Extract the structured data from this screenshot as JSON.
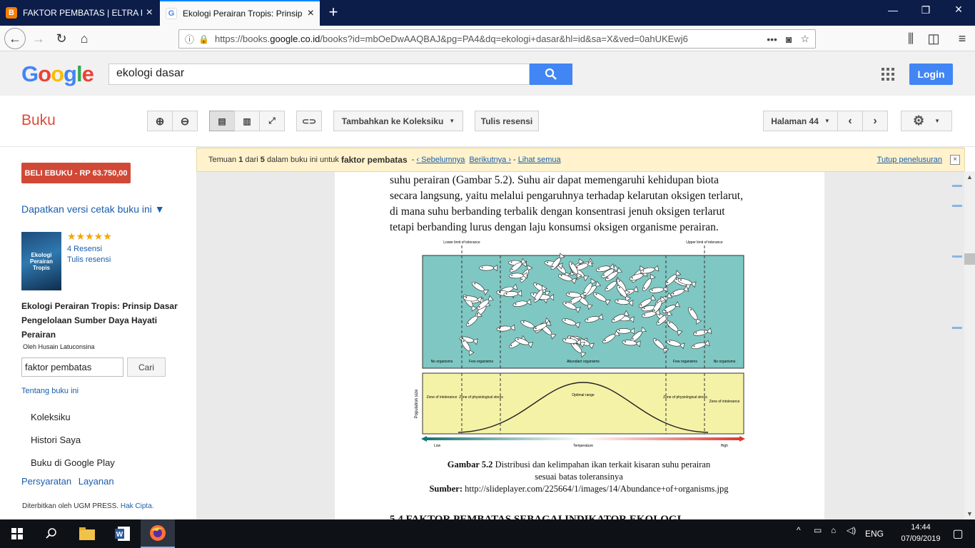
{
  "browser": {
    "tabs": [
      {
        "title": "FAKTOR PEMBATAS | ELTRA BIO",
        "favicon": "blogger-icon"
      },
      {
        "title": "Ekologi Perairan Tropis: Prinsip",
        "favicon": "google-icon"
      }
    ],
    "url_prefix": "https://books.",
    "url_domain": "google.co.id",
    "url_rest": "/books?id=mbOeDwAAQBAJ&pg=PA4&dq=ekologi+dasar&hl=id&sa=X&ved=0ahUKEwj6",
    "url_more": "•••"
  },
  "google": {
    "logo": "Google",
    "search_value": "ekologi dasar",
    "login_label": "Login"
  },
  "toolbar": {
    "section_title": "Buku",
    "add_collection_label": "Tambahkan ke Koleksiku",
    "write_review_label": "Tulis resensi",
    "page_label": "Halaman 44"
  },
  "sidebar": {
    "buy_label": "BELI EBUKU - RP 63.750,00",
    "print_version_label": "Dapatkan versi cetak buku ini ▼",
    "cover_text": "Ekologi Perairan Tropis",
    "rating_stars": "★★★★★",
    "reviews_label": "4 Resensi",
    "write_review_label": "Tulis resensi",
    "book_title": "Ekologi Perairan Tropis: Prinsip Dasar Pengelolaan Sumber Daya Hayati Perairan",
    "author": "Oleh Husain Latuconsina",
    "search_value": "faktor pembatas",
    "search_button": "Cari",
    "about_label": "Tentang buku ini",
    "menu": [
      "Koleksiku",
      "Histori Saya",
      "Buku di Google Play"
    ],
    "terms_label": "Persyaratan",
    "services_label": "Layanan",
    "publisher_text": "Diterbitkan oleh UGM PRESS.",
    "copyright_label": "Hak Cipta."
  },
  "notice": {
    "prefix": "Temuan",
    "current": "1",
    "middle": "dari",
    "total": "5",
    "suffix": "dalam buku ini untuk",
    "term": "faktor pembatas",
    "prev": "‹ Sebelumnya",
    "next": "Berikutnya ›",
    "see_all": "Lihat semua",
    "close": "Tutup penelusuran"
  },
  "page": {
    "lines": [
      "suhu perairan (Gambar 5.2). Suhu air dapat memengaruhi kehidupan biota",
      "secara langsung, yaitu melalui pengaruhnya terhadap kelarutan oksigen terlarut,",
      "di mana suhu berbanding terbalik dengan konsentrasi jenuh oksigen terlarut",
      "tetapi berbanding lurus dengan laju konsumsi oksigen organisme perairan."
    ],
    "figure": {
      "lower_limit": "Lower limit of tolerance",
      "upper_limit": "Upper limit of tolerance",
      "zones_top": [
        "No organisms",
        "Few organisms",
        "Abundant organisms",
        "Few organisms",
        "No organisms"
      ],
      "zones_bottom": [
        "Zone of intolerance",
        "Zone of physiological stress",
        "Optimal range",
        "Zone of physiological stress",
        "Zone of intolerance"
      ],
      "y_axis": "Population size",
      "x_low": "Low",
      "x_mid": "Temperature",
      "x_high": "High"
    },
    "caption_label": "Gambar 5.2",
    "caption_line1": "Distribusi dan kelimpahan ikan terkait kisaran suhu perairan",
    "caption_line2": "sesuai batas toleransinya",
    "source_label": "Sumber:",
    "source_url": "http://slideplayer.com/225664/1/images/14/Abundance+of+organisms.jpg",
    "next_heading": "5.4   FAKTOR PEMBATAS SEBAGAI INDIKATOR EKOLOGI"
  },
  "taskbar": {
    "lang": "ENG",
    "time": "14:44",
    "date": "07/09/2019"
  },
  "colors": {
    "google_blue": "#4285f4",
    "buku_red": "#dd4b39",
    "buy_red": "#d14836",
    "notice_bg": "#fff2cc",
    "figure_teal": "#7fc7c2",
    "figure_yellow": "#f4f2a6"
  }
}
